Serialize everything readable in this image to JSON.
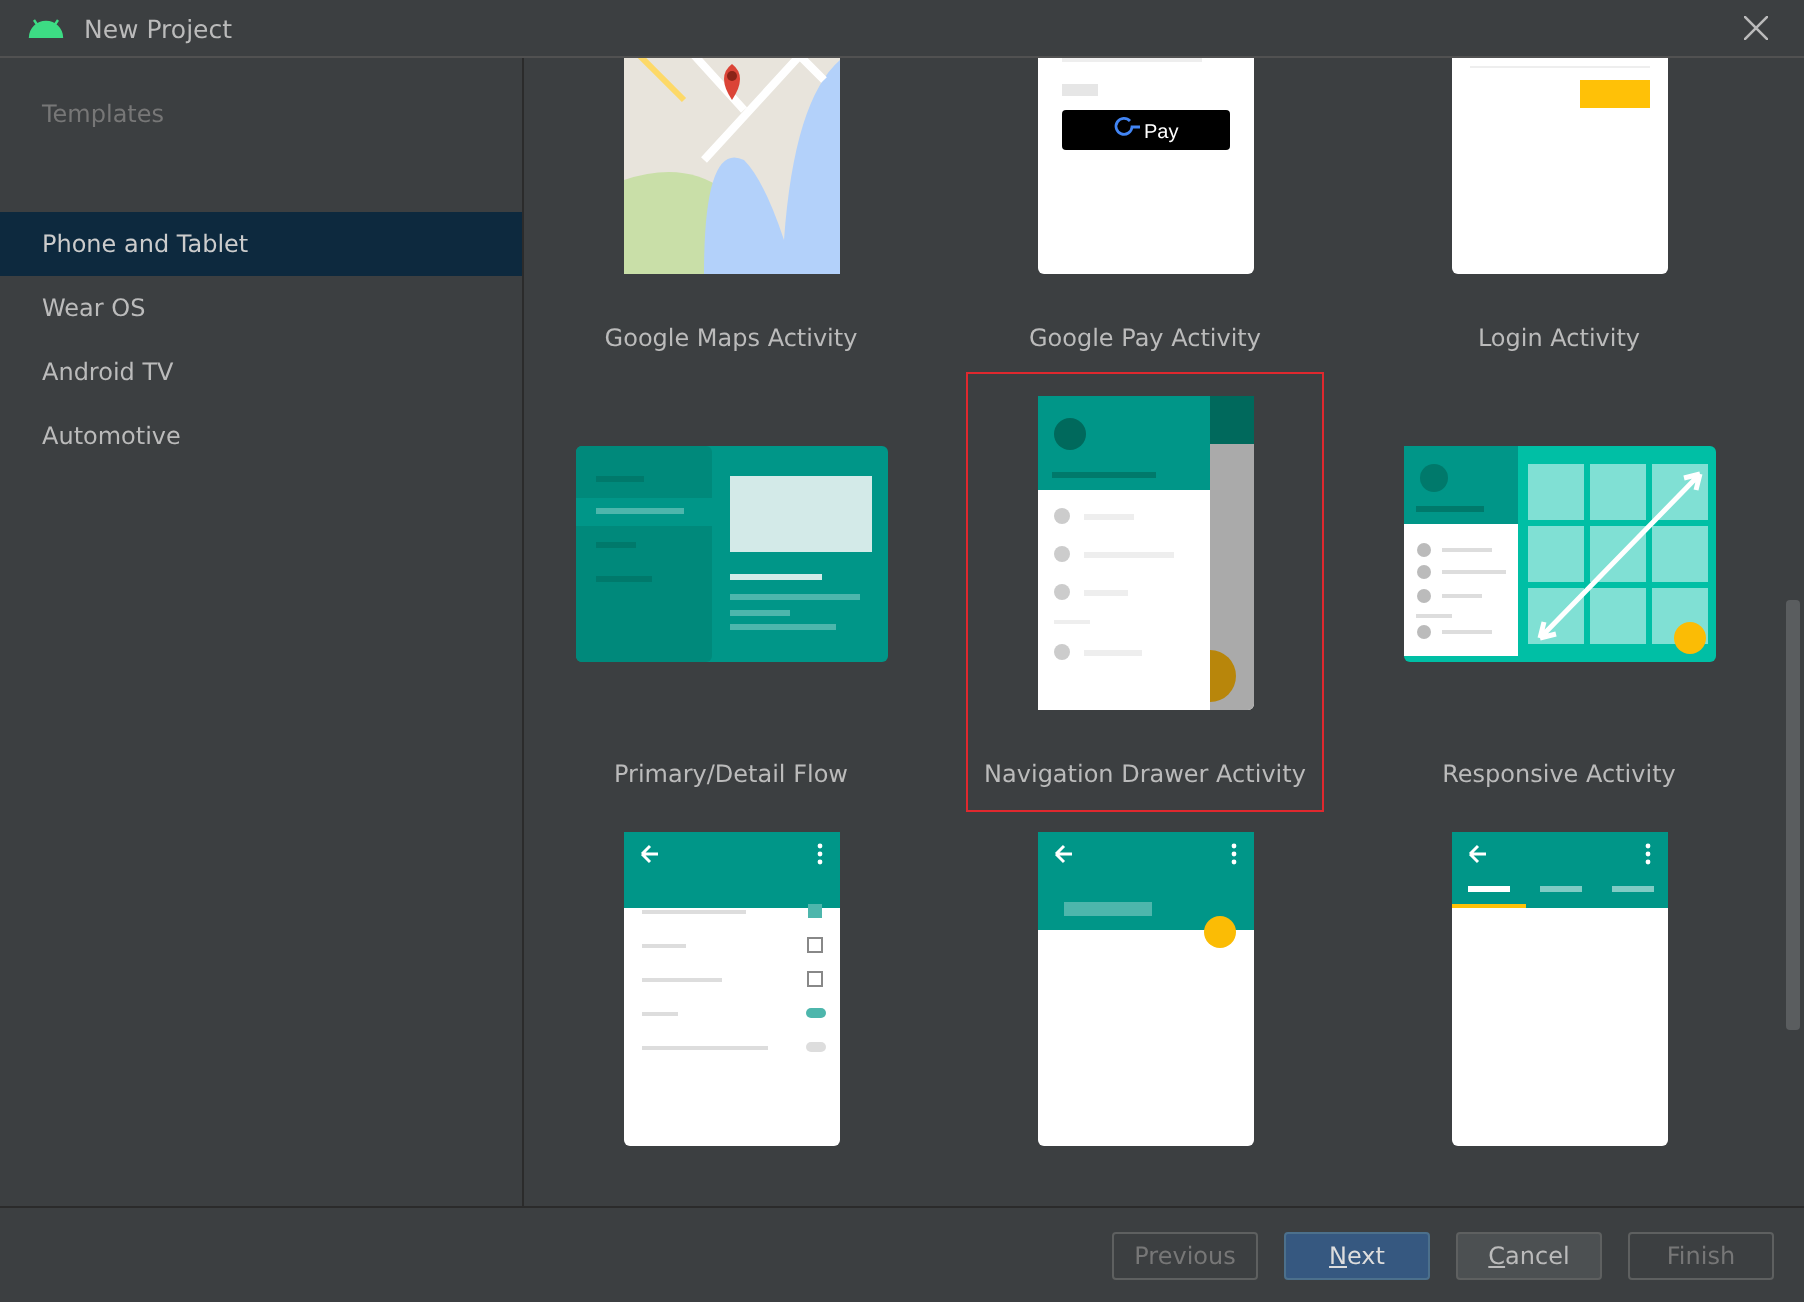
{
  "window": {
    "title": "New Project"
  },
  "sidebar": {
    "heading": "Templates",
    "items": [
      {
        "label": "Phone and Tablet",
        "selected": true
      },
      {
        "label": "Wear OS",
        "selected": false
      },
      {
        "label": "Android TV",
        "selected": false
      },
      {
        "label": "Automotive",
        "selected": false
      }
    ]
  },
  "templates": [
    {
      "kind": "maps",
      "name": "Google Maps Activity",
      "selected": false
    },
    {
      "kind": "pay",
      "name": "Google Pay Activity",
      "selected": false,
      "pay_label": "Pay"
    },
    {
      "kind": "login",
      "name": "Login Activity",
      "selected": false
    },
    {
      "kind": "primary_detail",
      "name": "Primary/Detail Flow",
      "selected": false
    },
    {
      "kind": "nav_drawer",
      "name": "Navigation Drawer Activity",
      "selected": true
    },
    {
      "kind": "responsive",
      "name": "Responsive Activity",
      "selected": false
    },
    {
      "kind": "settings",
      "selected": false
    },
    {
      "kind": "scrolling",
      "selected": false
    },
    {
      "kind": "tabbed",
      "selected": false
    }
  ],
  "buttons": [
    {
      "label": "Previous",
      "disabled": true,
      "default": false,
      "underline_first": false
    },
    {
      "label": "Next",
      "disabled": false,
      "default": true,
      "underline_first": true
    },
    {
      "label": "Cancel",
      "disabled": false,
      "default": false,
      "underline_first": true
    },
    {
      "label": "Finish",
      "disabled": true,
      "default": false,
      "underline_first": false
    }
  ]
}
